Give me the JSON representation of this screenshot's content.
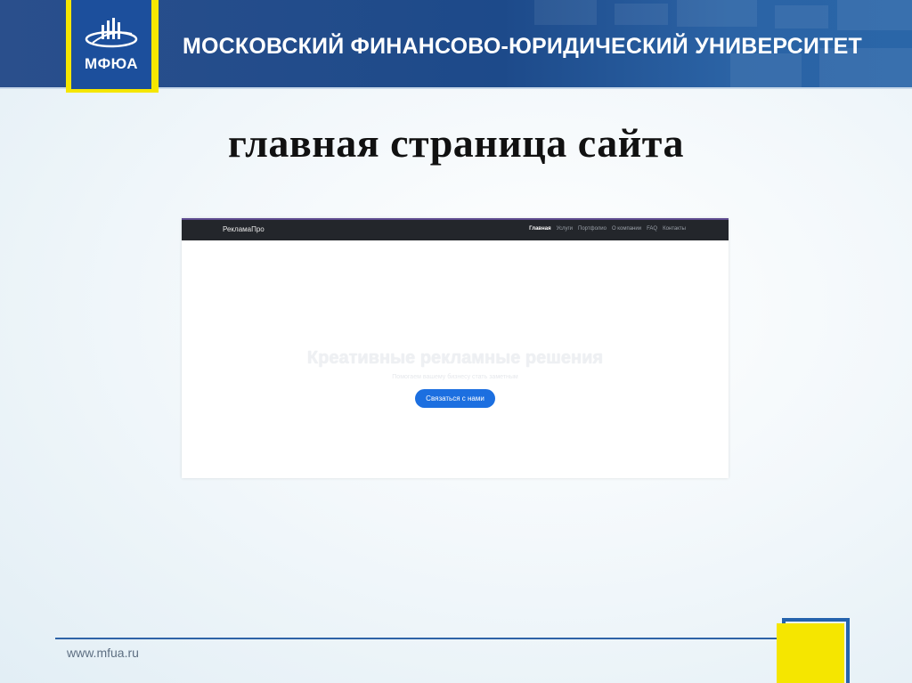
{
  "header": {
    "logo_text": "МФЮА",
    "university_name": "МОСКОВСКИЙ ФИНАНСОВО-ЮРИДИЧЕСКИЙ УНИВЕРСИТЕТ"
  },
  "slide": {
    "title": "главная страница сайта"
  },
  "website": {
    "brand": "РекламаПро",
    "nav": [
      {
        "label": "Главная",
        "active": true
      },
      {
        "label": "Услуги",
        "active": false
      },
      {
        "label": "Портфолио",
        "active": false
      },
      {
        "label": "О компании",
        "active": false
      },
      {
        "label": "FAQ",
        "active": false
      },
      {
        "label": "Контакты",
        "active": false
      }
    ],
    "hero_title": "Креативные рекламные решения",
    "hero_subtitle": "Помогаем вашему бизнесу стать заметным",
    "cta_label": "Связаться с нами"
  },
  "footer": {
    "url": "www.mfua.ru"
  },
  "colors": {
    "brand_blue": "#1c4f9c",
    "accent_yellow": "#f5e600",
    "cta_blue": "#1c6fe0"
  }
}
